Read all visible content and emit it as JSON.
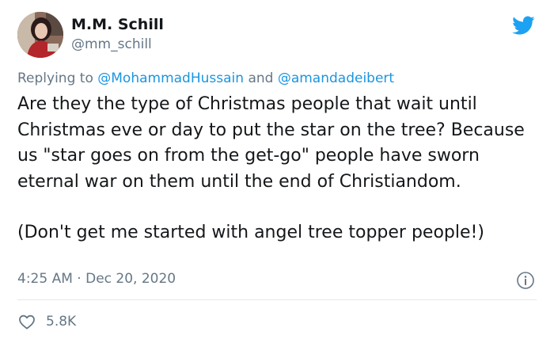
{
  "author": {
    "display_name": "M.M. Schill",
    "handle": "@mm_schill"
  },
  "icons": {
    "platform": "twitter-bird-icon",
    "info": "info-icon",
    "like": "heart-icon"
  },
  "colors": {
    "brand": "#1da1f2",
    "link": "#1b95e0",
    "muted": "#657786",
    "text": "#14171a"
  },
  "reply": {
    "prefix": "Replying to",
    "mention_1": "@MohammadHussain",
    "joiner": "and",
    "mention_2": "@amandadeibert"
  },
  "tweet": {
    "paragraph_1": "Are they the type of Christmas people that wait until Christmas eve or day to put the star on the tree? Because us \"star goes on from the get-go\" people have sworn eternal war on them until the end of Christiandom.",
    "paragraph_2": "(Don't get me started with angel tree topper people!)"
  },
  "meta": {
    "time": "4:25 AM",
    "separator": "·",
    "date": "Dec 20, 2020"
  },
  "engagement": {
    "likes": "5.8K"
  }
}
